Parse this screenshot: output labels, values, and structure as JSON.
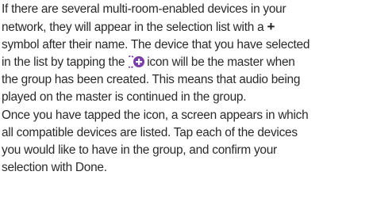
{
  "lines": [
    "If there are several multi-room-enabled devices in your",
    "network, they will appear in the selection list with a",
    "+",
    "symbol after their name. The device that you have selected",
    "in the list by tapping the",
    "icon will be the master when",
    "the group has been created. This means that audio being",
    "played on the master is continued in the group.",
    "Once you have tapped the icon, a screen appears in which",
    "all compatible devices are listed. Tap each of the devices",
    "you would like to have in the group, and confirm your",
    "selection with Done."
  ],
  "icons": {
    "group_add_icon": "group-add-icon",
    "accent": "#7b3fa8",
    "accent_dark": "#5c2a85"
  }
}
